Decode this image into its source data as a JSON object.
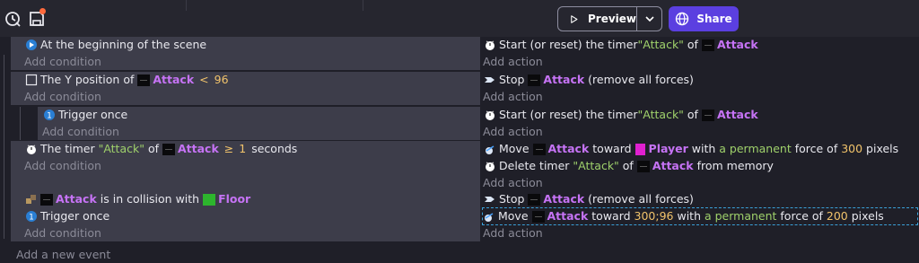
{
  "toolbar": {
    "preview_label": "Preview",
    "share_label": "Share",
    "accent": "#5b3fe0",
    "unsaved_dot_color": "#ff6a3d"
  },
  "events": [
    {
      "conditions": [
        "At the beginning of the scene"
      ],
      "add_condition": "Add condition",
      "actions": [
        {
          "text": [
            "Start (or reset) the timer ",
            "\"Attack\"",
            " of ",
            "Attack"
          ]
        }
      ],
      "add_action": "Add action"
    },
    {
      "conditions": [
        "The Y position of ",
        "Attack",
        "<",
        "96"
      ],
      "add_condition": "Add condition",
      "actions": [
        {
          "text": [
            "Stop ",
            "Attack",
            " (remove all forces)"
          ]
        }
      ],
      "add_action": "Add action"
    },
    {
      "conditions": [
        "Trigger once"
      ],
      "add_condition": "Add condition",
      "actions": [
        {
          "text": [
            "Start (or reset) the timer ",
            "\"Attack\"",
            " of ",
            "Attack"
          ]
        }
      ],
      "add_action": "Add action"
    },
    {
      "conditions": [
        "The timer ",
        "\"Attack\"",
        " of ",
        "Attack",
        "≥",
        "1",
        "seconds"
      ],
      "add_condition": "Add condition",
      "actions": [
        {
          "text": [
            "Move ",
            "Attack",
            " toward ",
            "Player",
            " with ",
            "a permanent",
            " force of ",
            "300",
            " pixels"
          ]
        },
        {
          "text": [
            "Delete timer ",
            "\"Attack\"",
            " of ",
            "Attack",
            " from memory"
          ]
        }
      ],
      "add_action": "Add action"
    },
    {
      "conditions": [
        "Attack",
        " is in collision with ",
        "Floor"
      ],
      "sub_conditions": [
        "Trigger once"
      ],
      "add_condition": "Add condition",
      "actions": [
        {
          "text": [
            "Stop ",
            "Attack",
            " (remove all forces)"
          ]
        },
        {
          "text": [
            "Move ",
            "Attack",
            " toward ",
            "300;96",
            " with ",
            "a permanent",
            " force of ",
            "200",
            " pixels"
          ]
        }
      ],
      "add_action": "Add action"
    }
  ],
  "add_event": "Add a new event"
}
